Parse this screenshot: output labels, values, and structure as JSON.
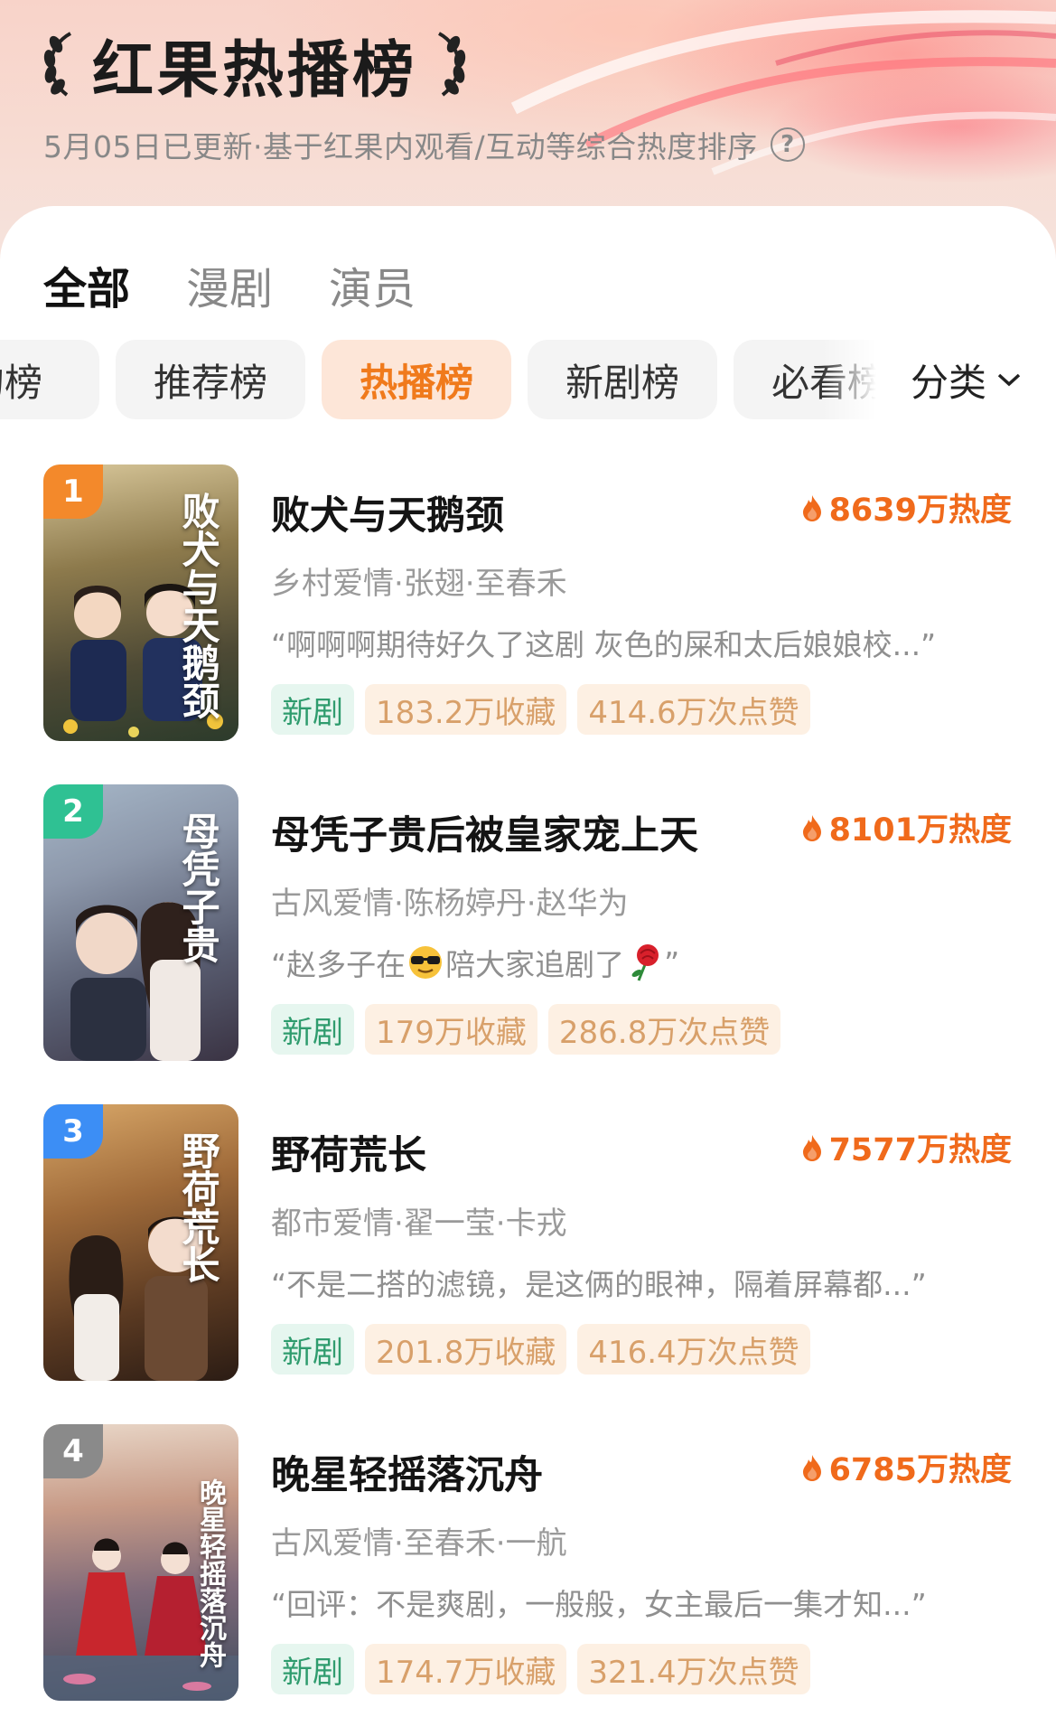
{
  "header": {
    "title": "红果热播榜",
    "subtitle": "5月05日已更新·基于红果内观看/互动等综合热度排序",
    "help_icon": "question-circle-icon"
  },
  "main_tabs": [
    {
      "label": "全部",
      "active": true
    },
    {
      "label": "漫剧",
      "active": false
    },
    {
      "label": "演员",
      "active": false
    }
  ],
  "sub_tabs": [
    {
      "label": "的榜",
      "active": false
    },
    {
      "label": "推荐榜",
      "active": false
    },
    {
      "label": "热播榜",
      "active": true
    },
    {
      "label": "新剧榜",
      "active": false
    },
    {
      "label": "必看榜",
      "active": false
    }
  ],
  "category": {
    "label": "分类",
    "icon": "chevron-down-icon"
  },
  "items": [
    {
      "rank": "1",
      "rank_color": "#f3892b",
      "poster_text": "败犬与天鹅颈",
      "title": "败犬与天鹅颈",
      "heat": "8639万热度",
      "tags": "乡村爱情·张翅·至春禾",
      "quote": "“啊啊啊期待好久了这剧 灰色的屎和太后娘娘校...”",
      "badge_new": "新剧",
      "favorites": "183.2万收藏",
      "likes": "414.6万次点赞"
    },
    {
      "rank": "2",
      "rank_color": "#2fc193",
      "poster_text": "母凭子贵",
      "title": "母凭子贵后被皇家宠上天",
      "heat": "8101万热度",
      "tags": "古风爱情·陈杨婷丹·赵华为",
      "quote_before": "“赵多子在",
      "quote_after": "陪大家追剧了",
      "quote_end": "”",
      "badge_new": "新剧",
      "favorites": "179万收藏",
      "likes": "286.8万次点赞"
    },
    {
      "rank": "3",
      "rank_color": "#3c8ef5",
      "poster_text": "野荷荒长",
      "title": "野荷荒长",
      "heat": "7577万热度",
      "tags": "都市爱情·翟一莹·卡戎",
      "quote": "“不是二搭的滤镜，是这俩的眼神，隔着屏幕都...”",
      "badge_new": "新剧",
      "favorites": "201.8万收藏",
      "likes": "416.4万次点赞"
    },
    {
      "rank": "4",
      "rank_color": "#8a8a8a",
      "poster_text": "晚星轻摇落沉舟",
      "title": "晚星轻摇落沉舟",
      "heat": "6785万热度",
      "tags": "古风爱情·至春禾·一航",
      "quote": "“回评：不是爽剧，一般般，女主最后一集才知...”",
      "badge_new": "新剧",
      "favorites": "174.7万收藏",
      "likes": "321.4万次点赞"
    }
  ]
}
